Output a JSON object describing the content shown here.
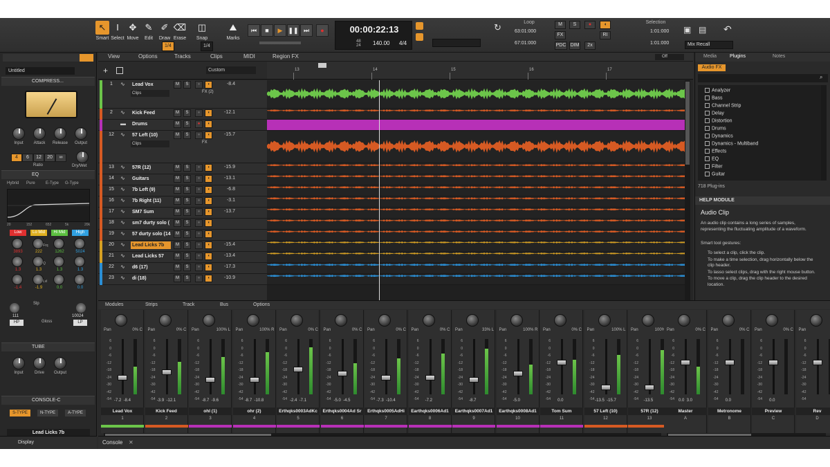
{
  "app": {
    "colors": {
      "accent": "#e6962c",
      "bg": "#2b2b2b",
      "green": "#6cc54a",
      "orange": "#d65a23",
      "purple": "#b730b7"
    }
  },
  "tools": [
    {
      "label": "Smart",
      "icon": "arrow-icon"
    },
    {
      "label": "Select",
      "icon": "ibeam-icon"
    },
    {
      "label": "Move",
      "icon": "move-icon"
    },
    {
      "label": "Edit",
      "icon": "edit-icon"
    },
    {
      "label": "Draw",
      "icon": "draw-icon"
    },
    {
      "label": "Erase",
      "icon": "erase-icon"
    },
    {
      "label": "Snap",
      "icon": "snap-icon"
    },
    {
      "label": "Marks",
      "icon": "marks-icon"
    }
  ],
  "toolbar": {
    "snap_value": "1/4",
    "snap_grid": "1/4",
    "now_time": "00:00:22:13",
    "tempo": "140.00",
    "meter": "4/4",
    "meter_top": "48",
    "meter_bottom": "24",
    "loop_label": "Loop",
    "loop_start": "63:01:000",
    "loop_end": "67:01:000",
    "selection_label": "Selection",
    "sel_start": "1:01:000",
    "sel_end": "1:01:000",
    "mix_recall": "Mix Recall",
    "m": "M",
    "s": "S",
    "fx": "FX",
    "pdc": "PDC",
    "dim": "DIM",
    "two_x": "2x",
    "ri": "RI"
  },
  "trackview_menu": [
    "View",
    "Options",
    "Tracks",
    "Clips",
    "MIDI",
    "Region FX"
  ],
  "trackview": {
    "off": "Off",
    "custom": "Custom",
    "ruler": [
      "13",
      "14",
      "15",
      "16",
      "17"
    ]
  },
  "tracks": [
    {
      "num": "1",
      "name": "Lead Vox",
      "vol": "-8.4",
      "color": "#6cc54a",
      "lane": "#6cc54a",
      "h": 40,
      "sub": "Clips",
      "fx": "FX (2)"
    },
    {
      "num": "2",
      "name": "Kick Feed",
      "vol": "-12.1",
      "color": "#d65a23",
      "lane": "#d65a23",
      "h": 15
    },
    {
      "num": "",
      "name": "Drums",
      "vol": "",
      "color": "#b730b7",
      "lane": "#b730b7",
      "h": 15,
      "folder": true
    },
    {
      "num": "12",
      "name": "57 Left (10)",
      "vol": "-15.7",
      "color": "#d65a23",
      "lane": "#d65a23",
      "h": 46,
      "sub": "Clips",
      "fx": "FX"
    },
    {
      "num": "13",
      "name": "57R (12)",
      "vol": "-15.9",
      "color": "#d65a23",
      "lane": "#d65a23",
      "h": 15
    },
    {
      "num": "14",
      "name": "Guitars",
      "vol": "-13.1",
      "color": "#d65a23",
      "lane": "#d65a23",
      "h": 15
    },
    {
      "num": "15",
      "name": "7b Left (9)",
      "vol": "-6.8",
      "color": "#d65a23",
      "lane": "#d65a23",
      "h": 15
    },
    {
      "num": "16",
      "name": "7b Right (11)",
      "vol": "-3.1",
      "color": "#d65a23",
      "lane": "#d65a23",
      "h": 15
    },
    {
      "num": "17",
      "name": "SM7 Sum",
      "vol": "-13.7",
      "color": "#d65a23",
      "lane": "#d65a23",
      "h": 15
    },
    {
      "num": "18",
      "name": "sm7 durty solo (",
      "vol": "",
      "color": "#d65a23",
      "lane": "#d65a23",
      "h": 15
    },
    {
      "num": "19",
      "name": "57 durty solo (14",
      "vol": "",
      "color": "#d65a23",
      "lane": "#d65a23",
      "h": 15
    },
    {
      "num": "20",
      "name": "Lead Licks 7b",
      "vol": "-15.4",
      "color": "#d6a023",
      "lane": "#d6a023",
      "h": 15,
      "hl": true
    },
    {
      "num": "21",
      "name": "Lead Licks 57",
      "vol": "-13.4",
      "color": "#d6a023",
      "lane": "#d6a023",
      "h": 15
    },
    {
      "num": "22",
      "name": "d6 (17)",
      "vol": "-17.3",
      "color": "#2a8fd6",
      "lane": "#2a8fd6",
      "h": 15
    },
    {
      "num": "23",
      "name": "di (18)",
      "vol": "-10.9",
      "color": "#2a8fd6",
      "lane": "#2a8fd6",
      "h": 15
    }
  ],
  "left": {
    "project": "Untitled",
    "compressor": "COMPRESS...",
    "comp_knobs": [
      "Input",
      "Attack",
      "Release",
      "Output"
    ],
    "ratios": [
      "4",
      "6",
      "12",
      "20",
      "∞"
    ],
    "ratio_label": "Ratio",
    "drywet": "Dry/Wet",
    "eq": "EQ",
    "eq_modes": [
      "Hybrid",
      "Pure",
      "E-Type",
      "G-Type"
    ],
    "eq_axis": [
      "20",
      "152",
      "652",
      "5k",
      "20k"
    ],
    "bands": [
      {
        "name": "Low",
        "color": "#e03030",
        "freq": "3893",
        "q": "1.3",
        "lvl": "-1.4"
      },
      {
        "name": "Lo Mid",
        "color": "#e0b020",
        "freq": "222",
        "q": "1.3",
        "lvl": "-1.9"
      },
      {
        "name": "Hi Mid",
        "color": "#5cc040",
        "freq": "1262",
        "q": "1.3",
        "lvl": "0.0"
      },
      {
        "name": "High",
        "color": "#30a0e0",
        "freq": "5024",
        "q": "1.3",
        "lvl": "0.0"
      }
    ],
    "freq_labels": [
      "Frq",
      "Q",
      "Lvl"
    ],
    "hp": "HP",
    "lp": "LP",
    "gloss": "Gloss",
    "hp_val": "111",
    "lp_val": "10024",
    "slp": "Slp",
    "tube": "TUBE",
    "tube_knobs": [
      "Input",
      "Drive",
      "Output"
    ],
    "console": "CONSOLE-C",
    "types": [
      "S-TYPE",
      "N-TYPE",
      "A-TYPE"
    ],
    "track_name": "Lead Licks 7b",
    "track_num": "20",
    "display": "Display"
  },
  "mixer_menu": [
    "Modules",
    "Strips",
    "Track",
    "Bus",
    "Options"
  ],
  "strips": [
    {
      "name": "Lead Vox",
      "num": "1",
      "pan": "0% C",
      "v1": "-7.2",
      "v2": "-8.4",
      "col": "#6cc54a",
      "cap": 52
    },
    {
      "name": "Kick Feed",
      "num": "2",
      "pan": "0% C",
      "v1": "-3.9",
      "v2": "-12.1",
      "col": "#d65a23",
      "cap": 44
    },
    {
      "name": "ohl (1)",
      "num": "3",
      "pan": "100% L",
      "v1": "-8.7",
      "v2": "-9.6",
      "col": "#b730b7",
      "cap": 55
    },
    {
      "name": "ohr (2)",
      "num": "4",
      "pan": "100% R",
      "v1": "-8.7",
      "v2": "-10.8",
      "col": "#b730b7",
      "cap": 55
    },
    {
      "name": "Erthqks0003AdKc",
      "num": "5",
      "pan": "0% C",
      "v1": "-2.4",
      "v2": "-7.1",
      "col": "#b730b7",
      "cap": 40
    },
    {
      "name": "Erthqks0004Ad Sr",
      "num": "6",
      "pan": "0% C",
      "v1": "-5.0",
      "v2": "-4.5",
      "col": "#b730b7",
      "cap": 46
    },
    {
      "name": "Erthqks0005AdHi",
      "num": "7",
      "pan": "0% C",
      "v1": "-7.3",
      "v2": "-10.4",
      "col": "#b730b7",
      "cap": 52
    },
    {
      "name": "Earthqks0006Ad1",
      "num": "8",
      "pan": "0% C",
      "v1": "-7.2",
      "v2": "",
      "col": "#b730b7",
      "cap": 52
    },
    {
      "name": "Earthqks0007Ad1",
      "num": "9",
      "pan": "33% L",
      "v1": "-8.7",
      "v2": "",
      "col": "#b730b7",
      "cap": 55
    },
    {
      "name": "Earthqks0008Ad1",
      "num": "10",
      "pan": "100% R",
      "v1": "-5.0",
      "v2": "",
      "col": "#b730b7",
      "cap": 46
    },
    {
      "name": "Tom Sum",
      "num": "11",
      "pan": "0% C",
      "v1": "0.0",
      "v2": "",
      "col": "#b730b7",
      "cap": 30
    },
    {
      "name": "57 Left (10)",
      "num": "12",
      "pan": "100% L",
      "v1": "-13.5",
      "v2": "-15.7",
      "col": "#d65a23",
      "cap": 66
    },
    {
      "name": "57R (12)",
      "num": "13",
      "pan": "100% R",
      "v1": "-13.5",
      "v2": "",
      "col": "#d65a23",
      "cap": 66
    }
  ],
  "bus_strips": [
    {
      "name": "Master",
      "num": "A",
      "pan": "0% C",
      "v1": "0.0",
      "v2": "3.0",
      "cap": 30
    },
    {
      "name": "Metronome",
      "num": "B",
      "pan": "0% C",
      "v1": "0.0",
      "v2": "",
      "cap": 30
    },
    {
      "name": "Preview",
      "num": "C",
      "pan": "0% C",
      "v1": "0.0",
      "v2": "",
      "cap": 30
    },
    {
      "name": "Rev",
      "num": "D",
      "pan": "",
      "v1": "",
      "v2": "",
      "cap": 30
    }
  ],
  "fader_scale": [
    "6",
    "0",
    "-6",
    "-12",
    "-18",
    "-24",
    "-30",
    "-42",
    "-54"
  ],
  "browser": {
    "tabs": [
      "Media",
      "Plugins",
      "Notes"
    ],
    "audio_fx": "Audio FX",
    "folders": [
      "Analyzer",
      "Bass",
      "Channel Strip",
      "Delay",
      "Distortion",
      "Drums",
      "Dynamics",
      "Dynamics - Multiband",
      "Effects",
      "EQ",
      "Filter",
      "Guitar"
    ],
    "count": "718 Plug-ins",
    "help_title": "HELP MODULE",
    "help_heading": "Audio Clip",
    "help_body": "An audio clip contains a long series of samples, representing the fluctuating amplitude of a waveform.",
    "help_sub": "Smart tool gestures:",
    "help_items": [
      "To select a clip, click the clip.",
      "To make a time selection, drag horizontally below the clip header.",
      "To lasso select clips, drag with the right mouse button.",
      "To move a clip, drag the clip header to the desired location."
    ]
  },
  "bottom": {
    "console": "Console"
  }
}
